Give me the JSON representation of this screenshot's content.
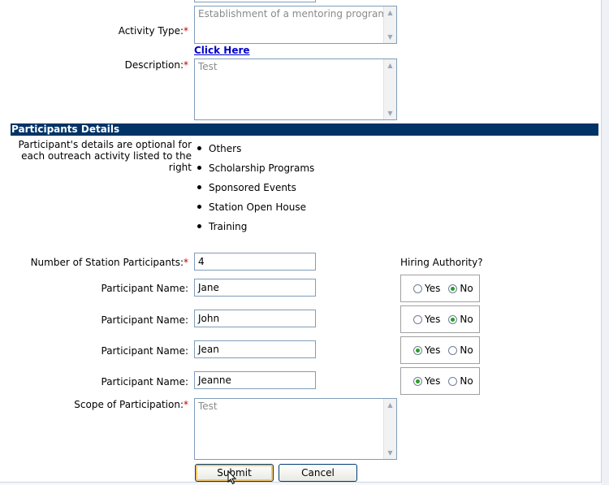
{
  "form": {
    "activity_type": {
      "label": "Activity Type:",
      "required_mark": "*",
      "value": "Establishment of a mentoring program",
      "help_link": "Click Here"
    },
    "description": {
      "label": "Description:",
      "required_mark": "*",
      "value": "Test"
    },
    "participants_section": {
      "title": "Participants Details",
      "note": "Participant's details are optional for each outreach activity listed to the right",
      "activities": [
        "Others",
        "Scholarship Programs",
        "Sponsored Events",
        "Station Open House",
        "Training"
      ]
    },
    "station_participants": {
      "label": "Number of Station Participants:",
      "required_mark": "*",
      "value": "4"
    },
    "hiring_authority_label": "Hiring Authority?",
    "participants": [
      {
        "label": "Participant Name:",
        "value": "Jane",
        "hiring": "No"
      },
      {
        "label": "Participant Name:",
        "value": "John",
        "hiring": "No"
      },
      {
        "label": "Participant Name:",
        "value": "Jean",
        "hiring": "Yes"
      },
      {
        "label": "Participant Name:",
        "value": "Jeanne",
        "hiring": "Yes"
      }
    ],
    "radio_yes": "Yes",
    "radio_no": "No",
    "scope": {
      "label": "Scope of Participation:",
      "required_mark": "*",
      "value": "Test"
    },
    "buttons": {
      "submit": "Submit",
      "cancel": "Cancel"
    }
  },
  "colors": {
    "section_bar": "#003366",
    "required": "#c00000",
    "link": "#0000cc",
    "radio_selected": "#21a121"
  }
}
